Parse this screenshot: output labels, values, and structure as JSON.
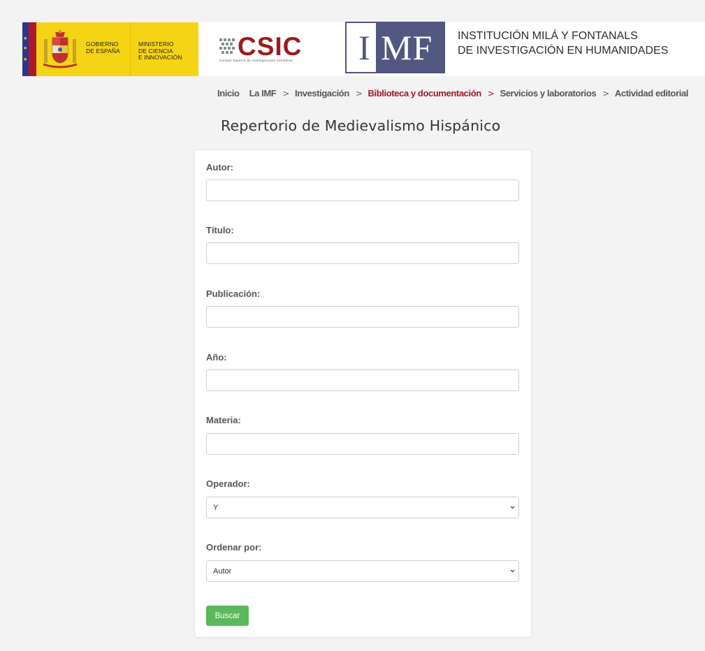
{
  "header": {
    "gobierno": "GOBIERNO\nDE ESPAÑA",
    "ministerio": "MINISTERIO\nDE CIENCIA\nE INNOVACIÓN",
    "csic_word": "CSIC",
    "csic_sub": "Consejo Superior de Investigaciones Científicas",
    "imf_i": "I",
    "imf_mf": "MF",
    "institution_line1": "INSTITUCIÓN MILÁ Y FONTANALS",
    "institution_line2": "DE INVESTIGACIÓN EN HUMANIDADES",
    "colors": {
      "gov_yellow": "#f5d415",
      "csic_red": "#9b1b1e",
      "imf_blue": "#525780"
    }
  },
  "nav": {
    "separator": ">",
    "items": [
      {
        "label": "Inicio"
      },
      {
        "label": "La IMF"
      },
      {
        "label": "Investigación"
      },
      {
        "label": "Biblioteca y documentación",
        "active": true
      },
      {
        "label": "Servicios y laboratorios"
      },
      {
        "label": "Actividad editorial"
      }
    ],
    "active_color": "#a3162a"
  },
  "page": {
    "title": "Repertorio de Medievalismo Hispánico"
  },
  "form": {
    "autor_label": "Autor:",
    "titulo_label": "Título:",
    "publicacion_label": "Publicación:",
    "anio_label": "Año:",
    "materia_label": "Materia:",
    "operador_label": "Operador:",
    "operador_value": "Y",
    "ordenar_label": "Ordenar por:",
    "ordenar_value": "Autor",
    "search_label": "Buscar",
    "search_color": "#5cb85c"
  }
}
